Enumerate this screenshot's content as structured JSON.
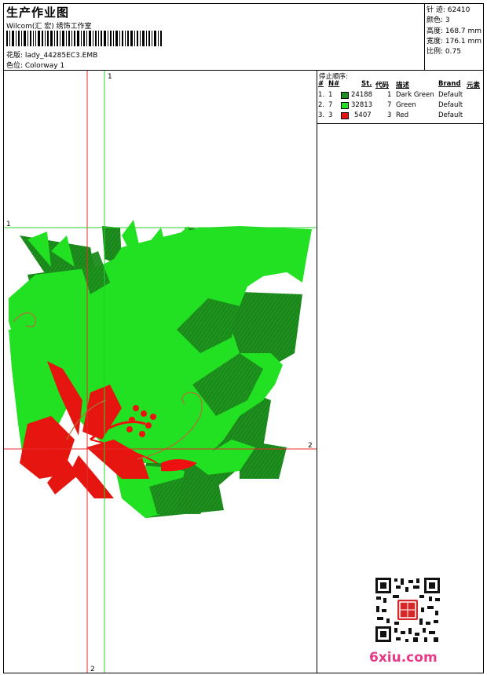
{
  "header": {
    "title": "生产作业图",
    "company": "Wilcom(汇 宏) 绣饰工作室",
    "pattern_line": "花版: lady_44285EC3.EMB",
    "colorway_line": "色位: Colorway 1"
  },
  "info": {
    "stitches": "针 迹: 62410",
    "colors": "颜色: 3",
    "height": "高度: 168.7 mm",
    "width": "宽度: 176.1 mm",
    "scale": "比例: 0.75"
  },
  "stop_sequence": {
    "title": "停止顺序:",
    "headers": [
      "#",
      "N#",
      "St.",
      "代码",
      "描述",
      "Brand",
      "元素"
    ],
    "rows": [
      {
        "num": "1.",
        "n": "1",
        "stitches": "24188",
        "code": "1",
        "desc": "Dark Green",
        "brand": "Default",
        "color": "#1e8f1e"
      },
      {
        "num": "2.",
        "n": "7",
        "stitches": "32813",
        "code": "7",
        "desc": "Green",
        "brand": "Default",
        "color": "#22e022"
      },
      {
        "num": "3.",
        "n": "3",
        "stitches": "5407",
        "code": "3",
        "desc": "Red",
        "brand": "Default",
        "color": "#ee1111"
      }
    ]
  },
  "guides": {
    "top_marker": "1",
    "left_marker": "1",
    "right_marker": "2",
    "bottom_marker": "2"
  },
  "watermark": "6xiu.com"
}
